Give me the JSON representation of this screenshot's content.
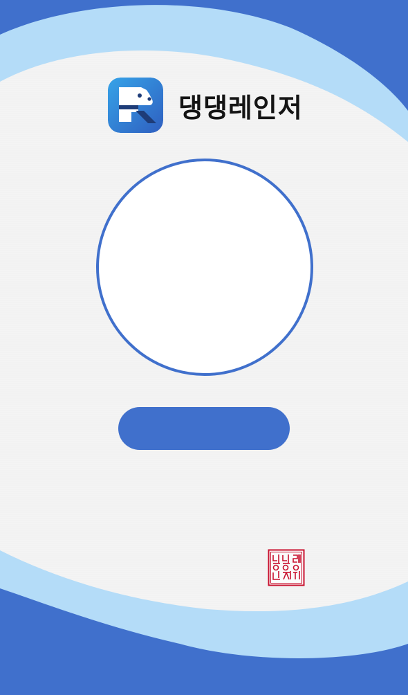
{
  "app": {
    "name": "댕댕레인저"
  },
  "logo": {
    "icon": "ranger-dog-logo-icon"
  },
  "profile": {
    "icon": "profile-photo-placeholder"
  },
  "main_button": {
    "label": ""
  },
  "seal": {
    "text": "댕댕레인저",
    "icon": "red-seal-stamp-icon"
  },
  "colors": {
    "primary": "#4070cc",
    "light_wave": "#b4dcf8",
    "paper": "#f4f4f4",
    "seal_red": "#c8102e",
    "text": "#141414"
  }
}
